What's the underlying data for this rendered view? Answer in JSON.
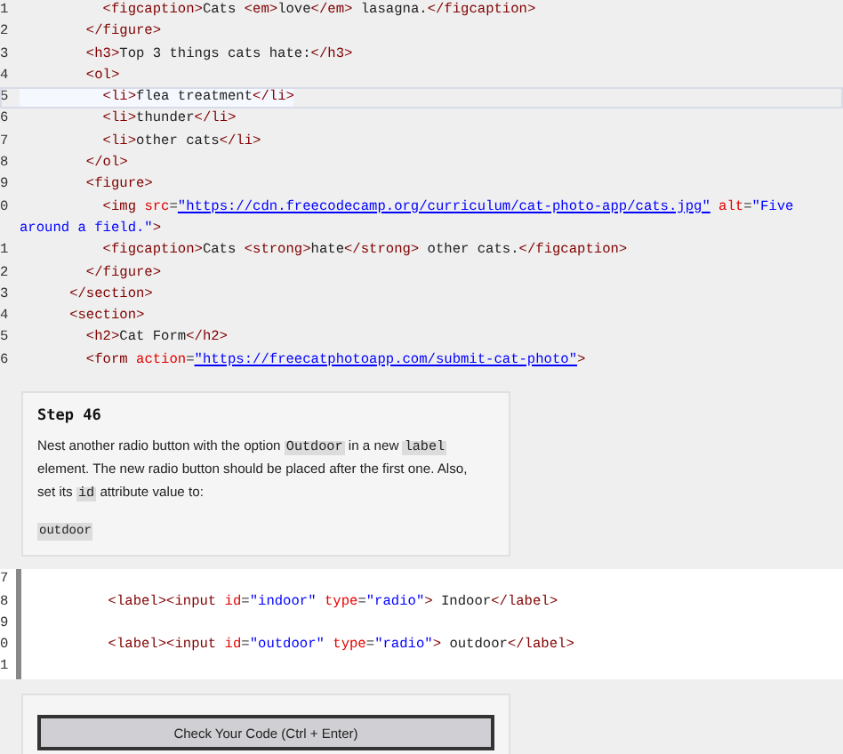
{
  "editor_top": {
    "lines": [
      {
        "number": "1",
        "active": false,
        "tokens": [
          {
            "kind": "tag",
            "text": "          <figcaption>"
          },
          {
            "kind": "text",
            "text": "Cats "
          },
          {
            "kind": "tag",
            "text": "<em>"
          },
          {
            "kind": "text",
            "text": "love"
          },
          {
            "kind": "tag",
            "text": "</em>"
          },
          {
            "kind": "text",
            "text": " lasagna."
          },
          {
            "kind": "tag",
            "text": "</figcaption>"
          }
        ]
      },
      {
        "number": "2",
        "active": false,
        "tokens": [
          {
            "kind": "tag",
            "text": "        </figure>"
          }
        ]
      },
      {
        "number": "3",
        "active": false,
        "tokens": [
          {
            "kind": "tag",
            "text": "        <h3>"
          },
          {
            "kind": "text",
            "text": "Top 3 things cats hate:"
          },
          {
            "kind": "tag",
            "text": "</h3>"
          }
        ]
      },
      {
        "number": "4",
        "active": false,
        "tokens": [
          {
            "kind": "tag",
            "text": "        <ol>"
          }
        ]
      },
      {
        "number": "5",
        "active": true,
        "tokens": [
          {
            "kind": "tag",
            "text": "          <li>"
          },
          {
            "kind": "text",
            "text": "flea treatment"
          },
          {
            "kind": "tag",
            "text": "</li>"
          }
        ]
      },
      {
        "number": "6",
        "active": false,
        "tokens": [
          {
            "kind": "tag",
            "text": "          <li>"
          },
          {
            "kind": "text",
            "text": "thunder"
          },
          {
            "kind": "tag",
            "text": "</li>"
          }
        ]
      },
      {
        "number": "7",
        "active": false,
        "tokens": [
          {
            "kind": "tag",
            "text": "          <li>"
          },
          {
            "kind": "text",
            "text": "other cats"
          },
          {
            "kind": "tag",
            "text": "</li>"
          }
        ]
      },
      {
        "number": "8",
        "active": false,
        "tokens": [
          {
            "kind": "tag",
            "text": "        </ol>"
          }
        ]
      },
      {
        "number": "9",
        "active": false,
        "tokens": [
          {
            "kind": "tag",
            "text": "        <figure>"
          }
        ]
      },
      {
        "number": "0",
        "active": false,
        "tokens": [
          {
            "kind": "tag",
            "text": "          <img "
          },
          {
            "kind": "attr",
            "text": "src"
          },
          {
            "kind": "punct",
            "text": "="
          },
          {
            "kind": "url",
            "text": "\"https://cdn.freecodecamp.org/curriculum/cat-photo-app/cats.jpg\""
          },
          {
            "kind": "attr",
            "text": " alt"
          },
          {
            "kind": "punct",
            "text": "="
          },
          {
            "kind": "string",
            "text": "\"Five"
          }
        ],
        "wrap_tokens": [
          {
            "kind": "string",
            "text": "around a field.\""
          },
          {
            "kind": "tag",
            "text": ">"
          }
        ]
      },
      {
        "number": "1",
        "active": false,
        "tokens": [
          {
            "kind": "tag",
            "text": "          <figcaption>"
          },
          {
            "kind": "text",
            "text": "Cats "
          },
          {
            "kind": "tag",
            "text": "<strong>"
          },
          {
            "kind": "text",
            "text": "hate"
          },
          {
            "kind": "tag",
            "text": "</strong>"
          },
          {
            "kind": "text",
            "text": " other cats."
          },
          {
            "kind": "tag",
            "text": "</figcaption>"
          }
        ]
      },
      {
        "number": "2",
        "active": false,
        "tokens": [
          {
            "kind": "tag",
            "text": "        </figure>"
          }
        ]
      },
      {
        "number": "3",
        "active": false,
        "tokens": [
          {
            "kind": "tag",
            "text": "      </section>"
          }
        ]
      },
      {
        "number": "4",
        "active": false,
        "tokens": [
          {
            "kind": "tag",
            "text": "      <section>"
          }
        ]
      },
      {
        "number": "5",
        "active": false,
        "tokens": [
          {
            "kind": "tag",
            "text": "        <h2>"
          },
          {
            "kind": "text",
            "text": "Cat Form"
          },
          {
            "kind": "tag",
            "text": "</h2>"
          }
        ]
      },
      {
        "number": "6",
        "active": false,
        "tokens": [
          {
            "kind": "tag",
            "text": "        <form "
          },
          {
            "kind": "attr",
            "text": "action"
          },
          {
            "kind": "punct",
            "text": "="
          },
          {
            "kind": "url",
            "text": "\"https://freecatphotoapp.com/submit-cat-photo\""
          },
          {
            "kind": "tag",
            "text": ">"
          }
        ]
      }
    ]
  },
  "step": {
    "title": "Step 46",
    "description": [
      {
        "kind": "text",
        "text": "Nest another radio button with the option "
      },
      {
        "kind": "code",
        "text": "Outdoor"
      },
      {
        "kind": "text",
        "text": " in a new "
      },
      {
        "kind": "code",
        "text": "label"
      },
      {
        "kind": "text",
        "text": " element. The new radio button should be placed after the first one. Also, set its "
      },
      {
        "kind": "code",
        "text": "id"
      },
      {
        "kind": "text",
        "text": " attribute value to:"
      }
    ],
    "value": "outdoor"
  },
  "editor_bottom": {
    "lines": [
      {
        "number": "7"
      },
      {
        "number": "8",
        "tokens": [
          {
            "kind": "tag",
            "text": "          <label><input "
          },
          {
            "kind": "attr",
            "text": "id"
          },
          {
            "kind": "punct",
            "text": "="
          },
          {
            "kind": "string",
            "text": "\"indoor\""
          },
          {
            "kind": "attr",
            "text": " type"
          },
          {
            "kind": "punct",
            "text": "="
          },
          {
            "kind": "string",
            "text": "\"radio\""
          },
          {
            "kind": "tag",
            "text": ">"
          },
          {
            "kind": "text",
            "text": " Indoor"
          },
          {
            "kind": "tag",
            "text": "</label>"
          }
        ]
      },
      {
        "number": "9"
      },
      {
        "number": "0",
        "tokens": [
          {
            "kind": "tag",
            "text": "          <label><input "
          },
          {
            "kind": "attr",
            "text": "id"
          },
          {
            "kind": "punct",
            "text": "="
          },
          {
            "kind": "string",
            "text": "\"outdoor\""
          },
          {
            "kind": "attr",
            "text": " type"
          },
          {
            "kind": "punct",
            "text": "="
          },
          {
            "kind": "string",
            "text": "\"radio\""
          },
          {
            "kind": "tag",
            "text": ">"
          },
          {
            "kind": "text",
            "text": " outdoor"
          },
          {
            "kind": "tag",
            "text": "</label>"
          }
        ]
      },
      {
        "number": "1"
      }
    ]
  },
  "check_button": {
    "label": "Check Your Code (Ctrl + Enter)"
  }
}
